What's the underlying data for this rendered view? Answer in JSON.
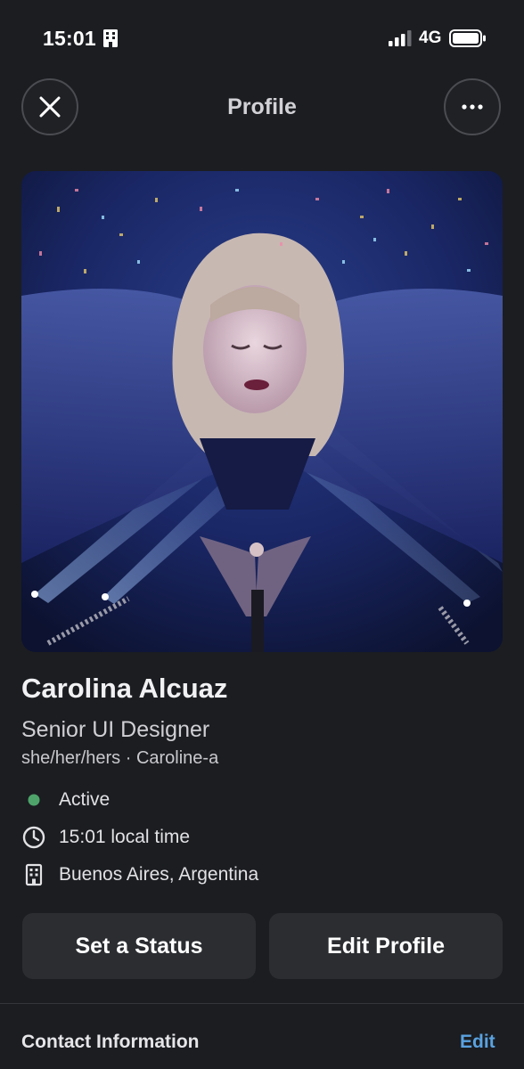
{
  "status_bar": {
    "time": "15:01",
    "network": "4G",
    "icons": [
      "building-icon",
      "cellular-signal-icon",
      "battery-icon"
    ]
  },
  "header": {
    "title": "Profile",
    "close_icon": "close-icon",
    "more_icon": "more-options-icon"
  },
  "profile": {
    "photo_description": "profile-photo",
    "name": "Carolina Alcuaz",
    "job_title": "Senior UI Designer",
    "pronouns_handle": "she/her/hers · Caroline-a",
    "status": "Active",
    "local_time": "15:01 local time",
    "location": "Buenos Aires, Argentina"
  },
  "actions": {
    "set_status": "Set a Status",
    "edit_profile": "Edit Profile"
  },
  "contact": {
    "title": "Contact Information",
    "edit": "Edit"
  },
  "colors": {
    "background": "#1b1d21",
    "button": "#2b2d31",
    "active_dot": "#4ea36a",
    "link": "#5aa2e0"
  }
}
